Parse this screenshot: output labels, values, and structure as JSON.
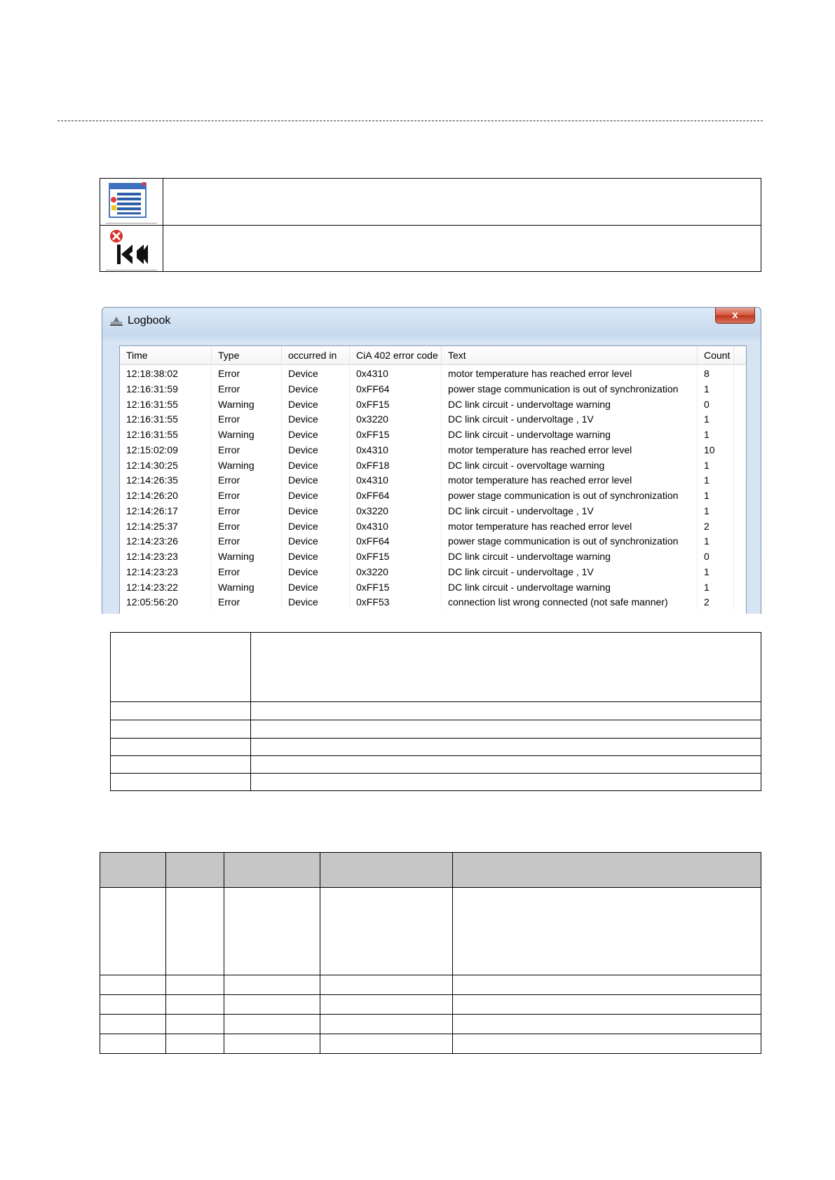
{
  "window": {
    "title": "Logbook",
    "close_label": "x"
  },
  "logbook": {
    "columns": [
      "Time",
      "Type",
      "occurred in",
      "CiA 402 error code",
      "Text",
      "Count"
    ],
    "rows": [
      [
        "12:18:38:02",
        "Error",
        "Device",
        "0x4310",
        "motor temperature has reached error level",
        "8"
      ],
      [
        "12:16:31:59",
        "Error",
        "Device",
        "0xFF64",
        "power stage communication is out of synchronization",
        "1"
      ],
      [
        "12:16:31:55",
        "Warning",
        "Device",
        "0xFF15",
        "DC link circuit - undervoltage warning",
        "0"
      ],
      [
        "12:16:31:55",
        "Error",
        "Device",
        "0x3220",
        "DC link circuit - undervoltage , 1V",
        "1"
      ],
      [
        "12:16:31:55",
        "Warning",
        "Device",
        "0xFF15",
        "DC link circuit - undervoltage warning",
        "1"
      ],
      [
        "12:15:02:09",
        "Error",
        "Device",
        "0x4310",
        "motor temperature has reached error level",
        "10"
      ],
      [
        "12:14:30:25",
        "Warning",
        "Device",
        "0xFF18",
        "DC link circuit - overvoltage warning",
        "1"
      ],
      [
        "12:14:26:35",
        "Error",
        "Device",
        "0x4310",
        "motor temperature has reached error level",
        "1"
      ],
      [
        "12:14:26:20",
        "Error",
        "Device",
        "0xFF64",
        "power stage communication is out of synchronization",
        "1"
      ],
      [
        "12:14:26:17",
        "Error",
        "Device",
        "0x3220",
        "DC link circuit - undervoltage , 1V",
        "1"
      ],
      [
        "12:14:25:37",
        "Error",
        "Device",
        "0x4310",
        "motor temperature has reached error level",
        "2"
      ],
      [
        "12:14:23:26",
        "Error",
        "Device",
        "0xFF64",
        "power stage communication is out of synchronization",
        "1"
      ],
      [
        "12:14:23:23",
        "Warning",
        "Device",
        "0xFF15",
        "DC link circuit - undervoltage warning",
        "0"
      ],
      [
        "12:14:23:23",
        "Error",
        "Device",
        "0x3220",
        "DC link circuit - undervoltage , 1V",
        "1"
      ],
      [
        "12:14:23:22",
        "Warning",
        "Device",
        "0xFF15",
        "DC link circuit - undervoltage warning",
        "1"
      ],
      [
        "12:05:56:20",
        "Error",
        "Device",
        "0xFF53",
        "connection list wrong connected (not safe manner)",
        "2"
      ]
    ]
  },
  "icons": {
    "row1": "logbook-icon",
    "row2": "clear-error-icon"
  },
  "colors": {
    "header_fill": "#c6c6c6",
    "window_frame": "#c7d9ee",
    "close_button": "#c0341c"
  }
}
